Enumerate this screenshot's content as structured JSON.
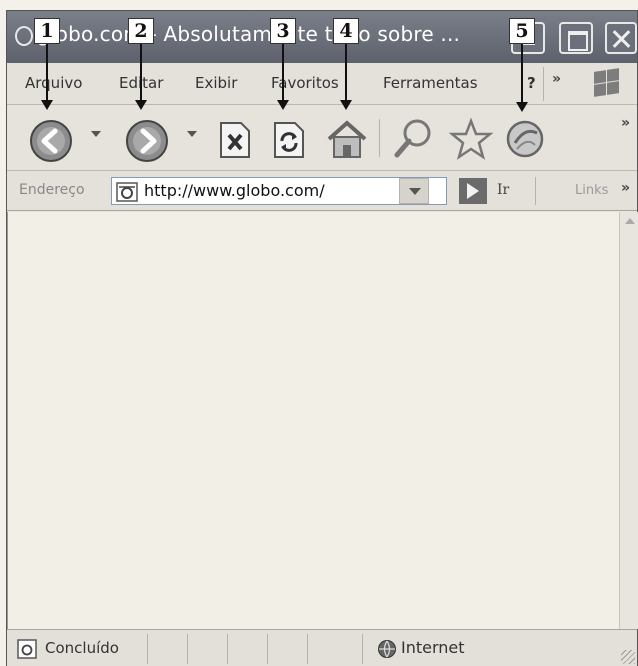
{
  "window": {
    "title": "globo.com - Absolutamente tudo sobre ..."
  },
  "menu": {
    "items": [
      "Arquivo",
      "Editar",
      "Exibir",
      "Favoritos",
      "Ferramentas",
      "?"
    ]
  },
  "toolbar": {
    "icons": [
      "back-icon",
      "forward-icon",
      "stop-icon",
      "refresh-icon",
      "home-icon",
      "search-icon",
      "favorites-icon",
      "media-icon"
    ]
  },
  "address": {
    "label": "Endereço",
    "url": "http://www.globo.com/",
    "go_label": "Ir",
    "links_label": "Links"
  },
  "status": {
    "text": "Concluído",
    "zone": "Internet"
  },
  "annotations": [
    "1",
    "2",
    "3",
    "4",
    "5"
  ]
}
